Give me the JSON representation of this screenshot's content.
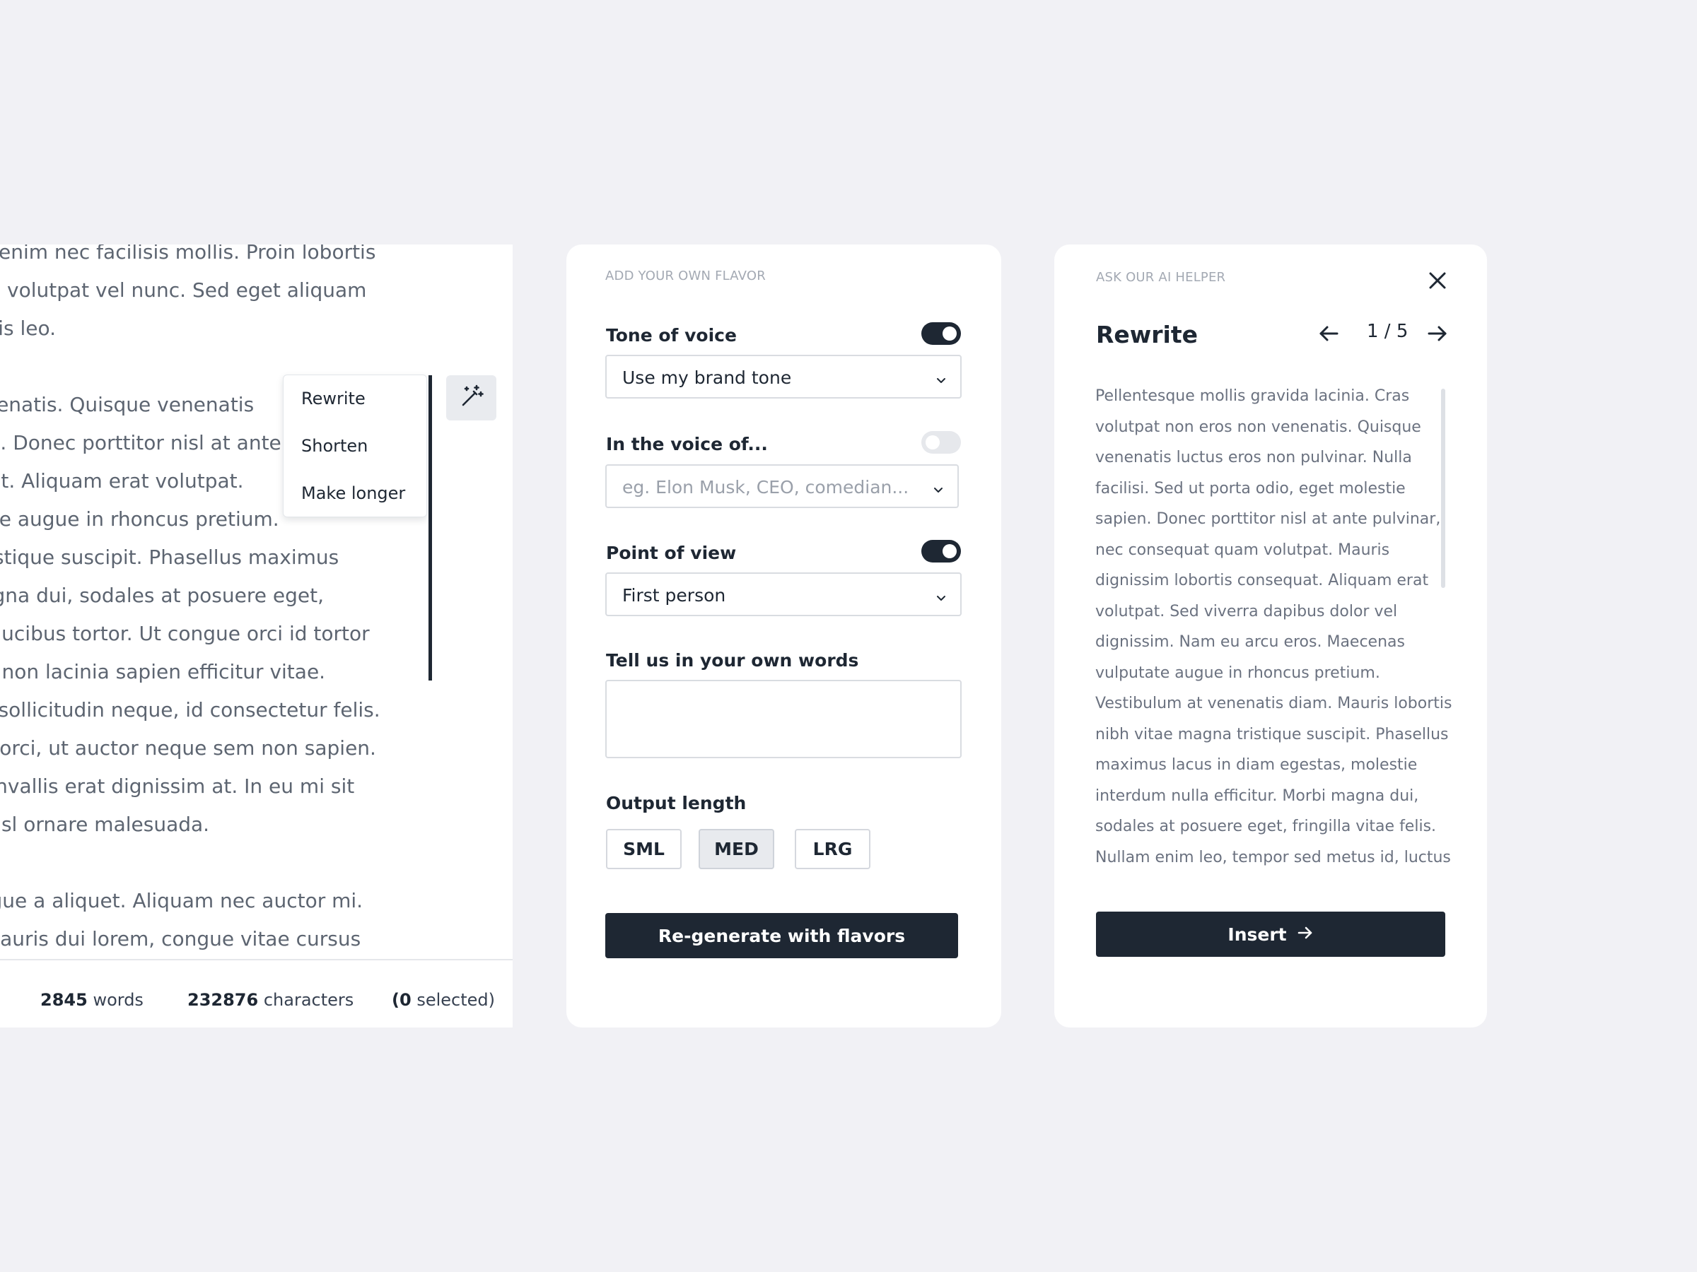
{
  "editor": {
    "paragraphs": [
      [
        "tibulum enim nec facilisis mollis. Proin lobortis",
        "arius ac, volutpat vel nunc. Sed eget aliquam",
        "ec mauris leo."
      ],
      [
        "non venenatis. Quisque venenatis",
        "e sapien. Donec porttitor nisl at ante",
        "onsequat. Aliquam erat volutpat.",
        "vulputate augue in rhoncus pretium.",
        "agna tristique suscipit. Phasellus maximus",
        "orbi magna dui, sodales at posuere eget,",
        "luctus faucibus tortor. Ut congue orci id tortor",
        "pit felis, non lacinia sapien efficitur vitae.",
        ". Cras a sollicitudin neque, id consectetur felis.",
        "ncorper orci, ut auctor neque sem non sapien.",
        "vitae convallis erat dignissim at. In eu mi sit",
        "nisl ut nisl ornare malesuada."
      ],
      [
        "cipit augue a aliquet. Aliquam nec auctor mi.",
        "s non. Mauris dui lorem, congue vitae cursus"
      ]
    ],
    "context_menu": [
      "Rewrite",
      "Shorten",
      "Make longer"
    ],
    "magic_button_icon": "magic-wand-icon",
    "footer": {
      "words_count": "2845",
      "words_label": "words",
      "chars_count": "232876",
      "chars_label": "characters",
      "selected_count": "(0",
      "selected_label": "selected)"
    }
  },
  "flavor": {
    "eyebrow": "ADD YOUR OWN FLAVOR",
    "tone": {
      "label": "Tone of voice",
      "enabled": true,
      "value": "Use my brand tone"
    },
    "voice": {
      "label": "In the voice of...",
      "enabled": false,
      "placeholder": "eg. Elon Musk, CEO, comedian..."
    },
    "pov": {
      "label": "Point of view",
      "enabled": true,
      "value": "First person"
    },
    "own_words": {
      "label": "Tell us in your own words",
      "value": ""
    },
    "output_length": {
      "label": "Output length",
      "options": [
        "SML",
        "MED",
        "LRG"
      ],
      "selected": "MED"
    },
    "regenerate_label": "Re-generate with flavors"
  },
  "ai_helper": {
    "eyebrow": "ASK OUR AI HELPER",
    "title": "Rewrite",
    "pager": "1 / 5",
    "lines": [
      "Pellentesque mollis gravida lacinia. Cras",
      "volutpat non eros non venenatis. Quisque",
      "venenatis luctus eros non pulvinar. Nulla",
      "facilisi. Sed ut porta odio, eget molestie",
      "sapien. Donec porttitor nisl at ante pulvinar,",
      "nec consequat quam volutpat. Mauris",
      "dignissim lobortis consequat. Aliquam erat",
      "volutpat. Sed viverra dapibus dolor vel",
      "dignissim. Nam eu arcu eros. Maecenas",
      "vulputate augue in rhoncus pretium.",
      "Vestibulum at venenatis diam. Mauris lobortis",
      "nibh vitae magna tristique suscipit. Phasellus",
      "maximus lacus in diam egestas, molestie",
      "interdum nulla efficitur. Morbi magna dui,",
      "sodales at posuere eget, fringilla vitae felis.",
      "Nullam enim leo, tempor sed metus id, luctus"
    ],
    "insert_label": "Insert"
  },
  "colors": {
    "background": "#f1f1f5",
    "primary": "#1e2733",
    "muted_text": "#6b7280"
  }
}
